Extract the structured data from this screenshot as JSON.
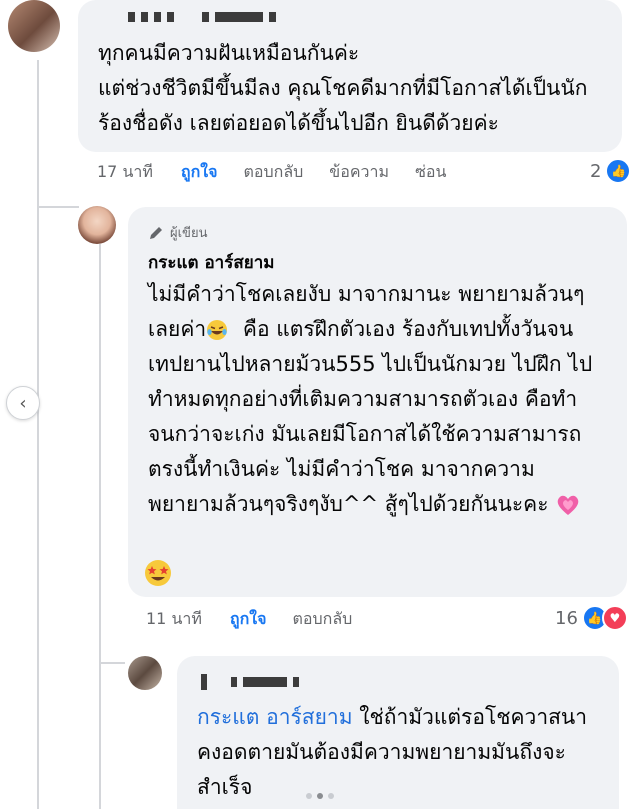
{
  "comment1": {
    "lines": [
      "ทุกคนมีความฝันเหมือนกันค่ะ",
      "แต่ช่วงชีวิตมีขึ้นมีลง คุณโชคดีมากที่มีโอกาสได้เป็นนัก",
      "ร้องชื่อดัง เลยต่อยอดได้ขึ้นไปอีก ยินดีด้วยค่ะ"
    ],
    "time": "17 นาที",
    "like": "ถูกใจ",
    "reply": "ตอบกลับ",
    "message": "ข้อความ",
    "hide": "ซ่อน",
    "reaction_count": "2"
  },
  "comment2": {
    "author_badge": "ผู้เขียน",
    "author": "กระแต อาร์สยาม",
    "lines": [
      "ไม่มีคำว่าโชคเลยงับ มาจากมานะ พยายามล้วนๆ",
      "คือ แตรฝึกตัวเอง ร้องกับเทปทั้งวันจน",
      "เทปยานไปหลายม้วน555 ไปเป็นนักมวย ไปฝึก ไป",
      "ทำหมดทุกอย่างที่เติมความสามารถตัวเอง คือทำ",
      "จนกว่าจะเก่ง มันเลยมีโอกาสได้ใช้ความสามารถ",
      "ตรงนี้ทำเงินค่ะ ไม่มีคำว่าโชค มาจากความ",
      "พยายามล้วนๆจริงๆงับ^^ สู้ๆไปด้วยกันนะคะ"
    ],
    "line2_prefix": "เลยค่า",
    "time": "11 นาที",
    "like": "ถูกใจ",
    "reply": "ตอบกลับ",
    "reaction_count": "16"
  },
  "comment3": {
    "mention": "กระแต อาร์สยาม",
    "line1_rest": " ใช่ถ้ามัวแต่รอโชควาสนา",
    "line2": "คงอดตายมันต้องมีความพยายามมันถึงจะ",
    "line3": "สำเร็จ"
  },
  "icons": {
    "like": "like-icon",
    "love": "love-icon",
    "pencil": "pencil-icon",
    "laughing": "laughing-emoji",
    "hearts": "growing-heart-emoji",
    "starstruck": "star-struck-emoji",
    "arrow": "chevron-left-icon"
  },
  "colors": {
    "bubble": "#f0f2f5",
    "link": "#1877f2",
    "mention": "#216fdb",
    "meta": "#65676b"
  }
}
